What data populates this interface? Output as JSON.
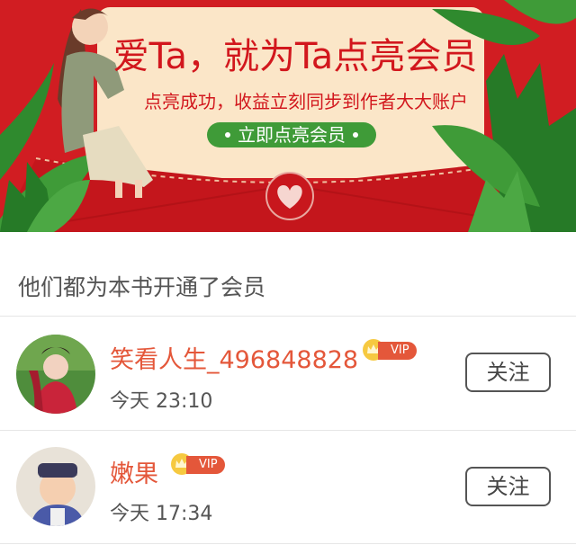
{
  "banner": {
    "headline": "爱Ta，就为Ta点亮会员",
    "subline": "点亮成功，收益立刻同步到作者大大账户",
    "cta_label": "立即点亮会员",
    "colors": {
      "background": "#d11d22",
      "card": "#fbe6c8",
      "accent": "#3f9b38"
    }
  },
  "section": {
    "title": "他们都为本书开通了会员"
  },
  "members": [
    {
      "name": "笑看人生_496848828",
      "vip_label": "VIP",
      "time": "今天 23:10",
      "follow_label": "关注"
    },
    {
      "name": "嫩果",
      "vip_label": "VIP",
      "time": "今天 17:34",
      "follow_label": "关注"
    }
  ],
  "colors": {
    "name": "#e4573a",
    "vip": "#e4573a",
    "text_secondary": "#555555"
  }
}
